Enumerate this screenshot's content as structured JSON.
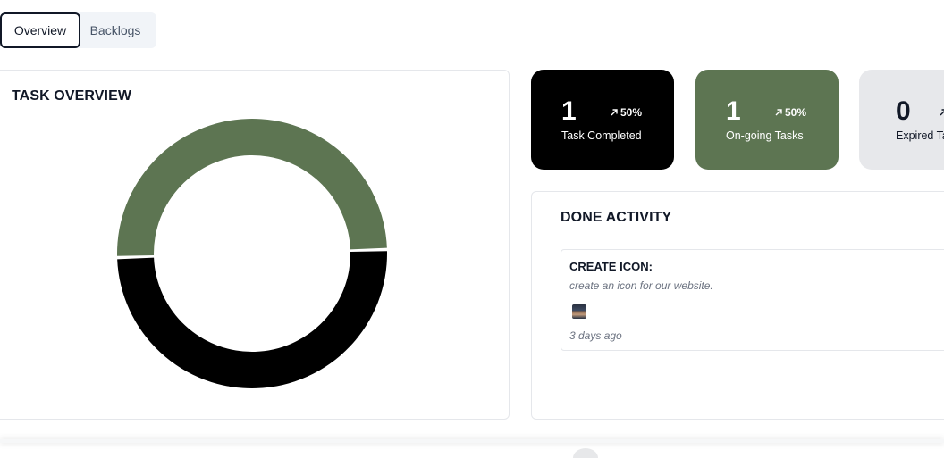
{
  "tabs": [
    {
      "label": "Overview",
      "active": true
    },
    {
      "label": "Backlogs",
      "active": false
    }
  ],
  "task_overview": {
    "title": "TASK OVERVIEW",
    "chart_data": {
      "type": "pie",
      "donut": true,
      "categories": [
        "On-going Tasks",
        "Task Completed"
      ],
      "values": [
        1,
        1
      ],
      "colors": [
        "#5d7552",
        "#000000"
      ]
    }
  },
  "stats": [
    {
      "value": "1",
      "change": "50%",
      "label": "Task Completed",
      "color": "#000000",
      "icon": "arrow-up-right-icon"
    },
    {
      "value": "1",
      "change": "50%",
      "label": "On-going Tasks",
      "color": "#5d7552",
      "icon": "arrow-up-right-icon"
    },
    {
      "value": "0",
      "change": "",
      "label": "Expired Ta",
      "color": "#e7e8eb",
      "icon": "arrow-up-right-icon"
    }
  ],
  "done_activity": {
    "title": "DONE ACTIVITY",
    "items": [
      {
        "name": "CREATE ICON:",
        "description": "create an icon for our website.",
        "time": "3 days ago"
      }
    ]
  }
}
